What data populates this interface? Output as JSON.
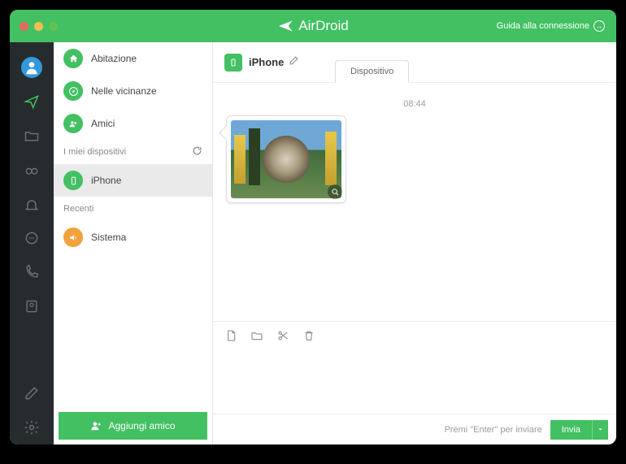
{
  "titlebar": {
    "brand": "AirDroid",
    "connection_guide": "Guida alla connessione"
  },
  "contacts": {
    "items": [
      {
        "label": "Abitazione"
      },
      {
        "label": "Nelle vicinanze"
      },
      {
        "label": "Amici"
      }
    ],
    "devices_header": "I miei dispositivi",
    "devices": [
      {
        "label": "iPhone"
      }
    ],
    "recent_header": "Recenti",
    "recent": [
      {
        "label": "Sistema"
      }
    ],
    "add_friend": "Aggiungi amico"
  },
  "chat": {
    "title": "iPhone",
    "tab": "Dispositivo",
    "timestamp": "08:44"
  },
  "footer": {
    "hint": "Premi \"Enter\" per inviare",
    "send": "Invia"
  }
}
